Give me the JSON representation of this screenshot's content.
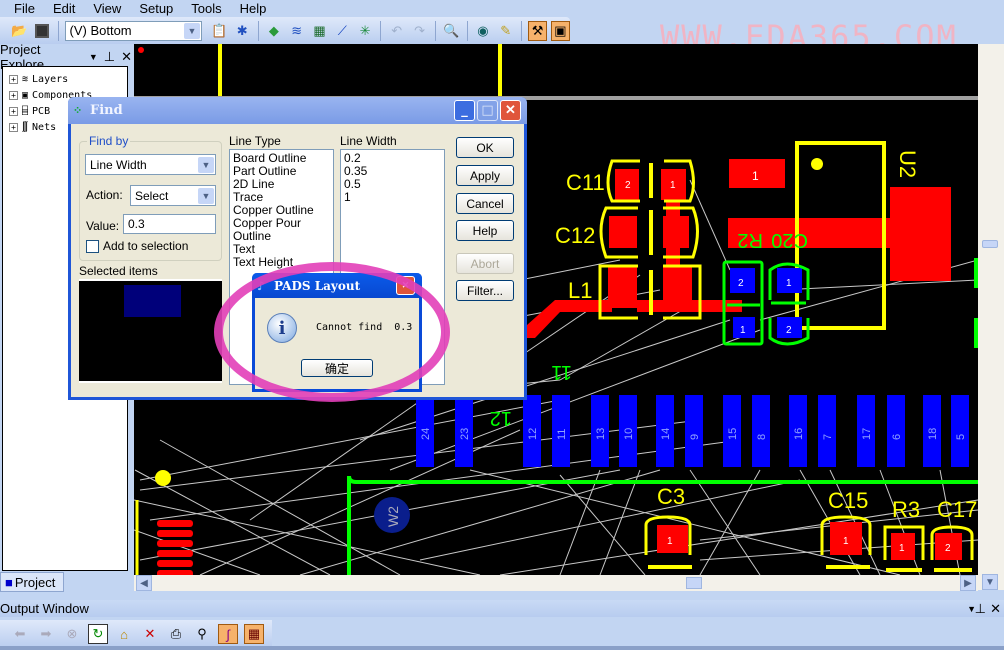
{
  "menu": [
    "File",
    "Edit",
    "View",
    "Setup",
    "Tools",
    "Help"
  ],
  "toolbar": {
    "layer_select": "(V) Bottom",
    "icons": [
      "open-icon",
      "save-icon",
      "properties-icon",
      "redraw-icon",
      "cam-icon",
      "pour-icon",
      "board-icon",
      "route-icon",
      "autorouter-icon",
      "undo-icon",
      "redo-icon",
      "zoom-icon",
      "view-icon",
      "brush-icon",
      "design-toolbar-icon",
      "window-icon"
    ]
  },
  "watermark": "WWW.EDA365.COM",
  "project_explorer": {
    "title": "Project Explore",
    "items": [
      "Layers",
      "Components",
      "PCB",
      "Nets"
    ],
    "tab": "Project"
  },
  "find_dialog": {
    "title": "Find",
    "find_by_label": "Find by",
    "find_by_value": "Line Width",
    "action_label": "Action:",
    "action_value": "Select",
    "value_label": "Value:",
    "value": "0.3",
    "add_to_selection": "Add to selection",
    "add_to_selection_checked": false,
    "selected_items_label": "Selected items",
    "line_type_label": "Line Type",
    "line_types": [
      "Board Outline",
      "Part Outline",
      "2D Line",
      "Trace",
      "Copper Outline",
      "Copper Pour Outline",
      "Text",
      "Text Height"
    ],
    "line_width_label": "Line Width",
    "line_widths": [
      "0.2",
      "0.35",
      "0.5",
      "1"
    ],
    "buttons": {
      "ok": "OK",
      "apply": "Apply",
      "cancel": "Cancel",
      "help": "Help",
      "abort": "Abort",
      "filter": "Filter..."
    }
  },
  "message_box": {
    "title": "PADS Layout",
    "message": "Cannot find  0.3",
    "ok": "确定"
  },
  "pcb": {
    "refs": {
      "c11": "C11",
      "c12": "C12",
      "l1": "L1",
      "u2": "U2",
      "r2": "R2",
      "c20": "C20",
      "c3": "C3",
      "c15": "C15",
      "r3": "R3",
      "c17": "C17",
      "w2": "W2",
      "n11": "11",
      "n12": "12"
    },
    "connector_pins": [
      "24",
      "23",
      "12",
      "11",
      "13",
      "10",
      "14",
      "9",
      "15",
      "8",
      "16",
      "7",
      "17",
      "6",
      "18",
      "5"
    ],
    "colors": {
      "top_copper": "#ff0000",
      "bottom_copper": "#0000ff",
      "silk_top": "#ffff00",
      "silk_bottom": "#00ff00",
      "ratsnest": "#c8c8c8"
    }
  },
  "output_window": {
    "title": "Output Window",
    "icons": [
      "back-icon",
      "forward-icon",
      "stop-icon",
      "refresh-icon",
      "home-icon",
      "delete-icon",
      "print-icon",
      "find-icon",
      "edit-icon",
      "grid-icon"
    ]
  }
}
